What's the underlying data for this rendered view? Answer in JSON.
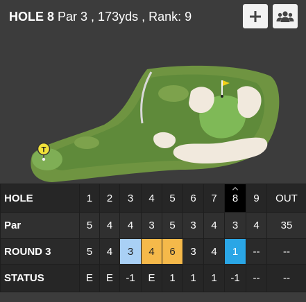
{
  "header": {
    "hole_label": "HOLE 8",
    "hole_info": "Par 3 , 173yds , Rank: 9",
    "add_icon": "plus-icon",
    "group_icon": "group-icon"
  },
  "map": {
    "tee_marker_label": "T",
    "pin_icon": "flag-icon"
  },
  "colors": {
    "background": "#3c3c3c",
    "birdie": "#a9d0f5",
    "bogey": "#f5b94a",
    "current_hole": "#2aa6e6"
  },
  "scorecard": {
    "current_hole": "8",
    "rows": [
      {
        "label": "HOLE",
        "cells": [
          "1",
          "2",
          "3",
          "4",
          "5",
          "6",
          "7",
          "8",
          "9",
          "OUT"
        ]
      },
      {
        "label": "Par",
        "cells": [
          "5",
          "4",
          "4",
          "3",
          "5",
          "3",
          "4",
          "3",
          "4",
          "35"
        ]
      },
      {
        "label": "ROUND 3",
        "cells": [
          "5",
          "4",
          "3",
          "4",
          "6",
          "3",
          "4",
          "1",
          "--",
          "--"
        ]
      },
      {
        "label": "STATUS",
        "cells": [
          "E",
          "E",
          "-1",
          "E",
          "1",
          "1",
          "1",
          "-1",
          "--",
          "--"
        ]
      }
    ]
  }
}
